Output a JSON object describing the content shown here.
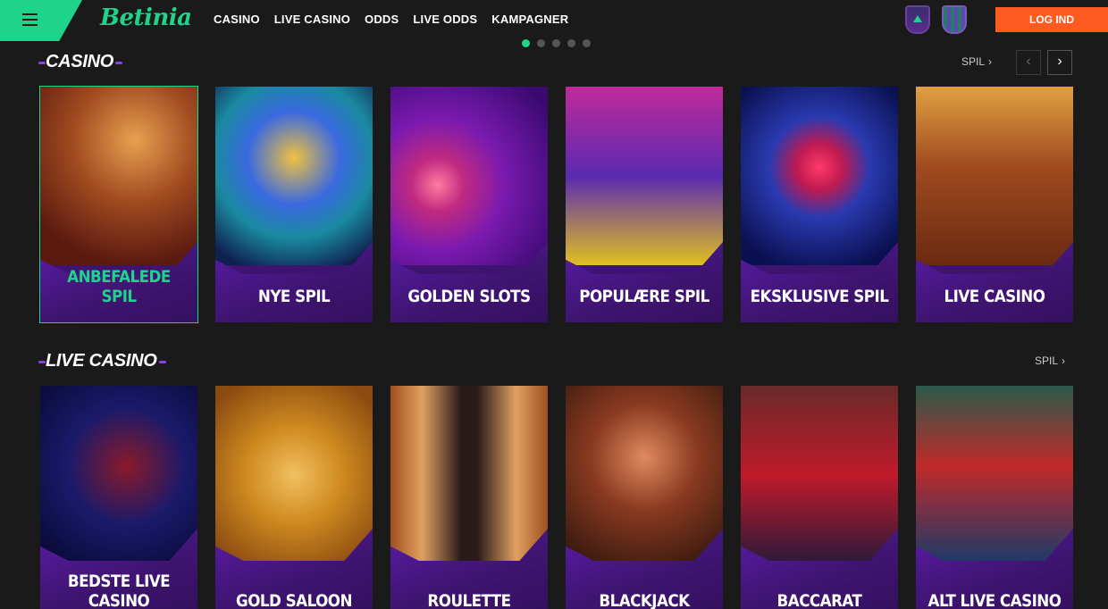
{
  "header": {
    "logo": "Betinia",
    "nav": [
      "CASINO",
      "LIVE CASINO",
      "ODDS",
      "LIVE ODDS",
      "KAMPAGNER"
    ],
    "login_label": "LOG IND"
  },
  "carousel": {
    "total": 5,
    "active_index": 0
  },
  "casino": {
    "title": "CASINO",
    "spil_label": "SPIL",
    "cards": [
      {
        "label": "ANBEFALEDE SPIL",
        "selected": true
      },
      {
        "label": "NYE SPIL"
      },
      {
        "label": "GOLDEN SLOTS"
      },
      {
        "label": "POPULÆRE SPIL"
      },
      {
        "label": "EKSKLUSIVE SPIL"
      },
      {
        "label": "LIVE CASINO"
      }
    ]
  },
  "live_casino": {
    "title": "LIVE CASINO",
    "spil_label": "SPIL",
    "cards": [
      {
        "label": "BEDSTE LIVE CASINO"
      },
      {
        "label": "GOLD SALOON"
      },
      {
        "label": "ROULETTE"
      },
      {
        "label": "BLACKJACK"
      },
      {
        "label": "BACCARAT"
      },
      {
        "label": "ALT LIVE CASINO"
      }
    ]
  },
  "colors": {
    "brand_green": "#1dd48a",
    "login_orange": "#ff5a1f",
    "card_purple": "#3e1470",
    "background": "#1a1a1a"
  },
  "icons": [
    "menu-icon",
    "team-badge-icon",
    "chevron-right-icon",
    "chevron-left-icon"
  ]
}
